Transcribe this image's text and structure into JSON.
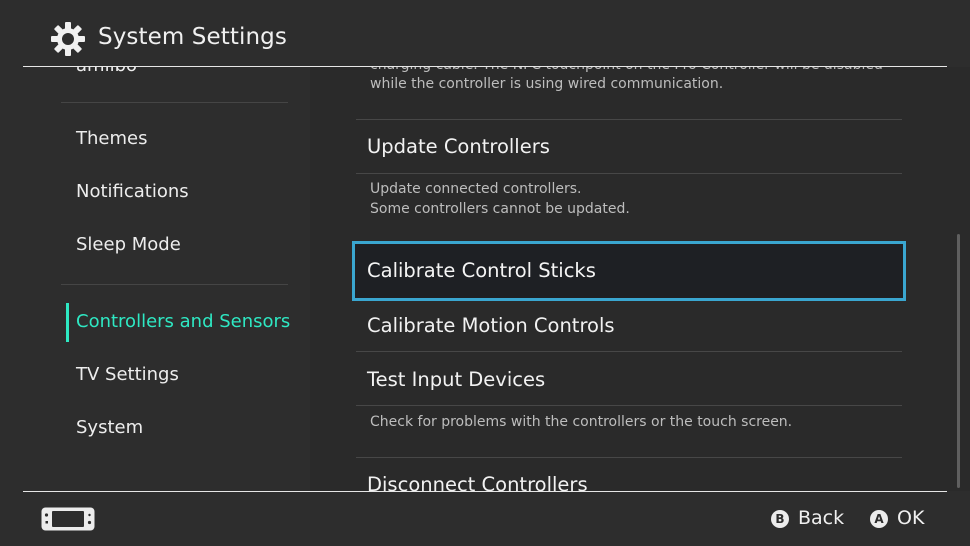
{
  "header": {
    "title": "System Settings",
    "icon": "gear-icon"
  },
  "sidebar": {
    "items": [
      {
        "label": "amiibo"
      },
      {
        "label": "Themes"
      },
      {
        "label": "Notifications"
      },
      {
        "label": "Sleep Mode"
      },
      {
        "label": "Controllers and Sensors",
        "active": true
      },
      {
        "label": "TV Settings"
      },
      {
        "label": "System"
      }
    ],
    "accent_color": "#2ee8c3"
  },
  "panel": {
    "top_desc_line1": "charging cable. The NFC touchpoint on the Pro Controller will be disabled",
    "top_desc_line2": "while the controller is using wired communication.",
    "update_label": "Update Controllers",
    "update_desc_line1": "Update connected controllers.",
    "update_desc_line2": "Some controllers cannot be updated.",
    "calibrate_sticks_label": "Calibrate Control Sticks",
    "calibrate_motion_label": "Calibrate Motion Controls",
    "test_input_label": "Test Input Devices",
    "test_input_desc": "Check for problems with the controllers or the touch screen.",
    "disconnect_label": "Disconnect Controllers",
    "selection_color": "#3aa6d0"
  },
  "footer": {
    "back_button_glyph": "B",
    "back_label": "Back",
    "ok_button_glyph": "A",
    "ok_label": "OK",
    "console_icon": "console-icon"
  }
}
